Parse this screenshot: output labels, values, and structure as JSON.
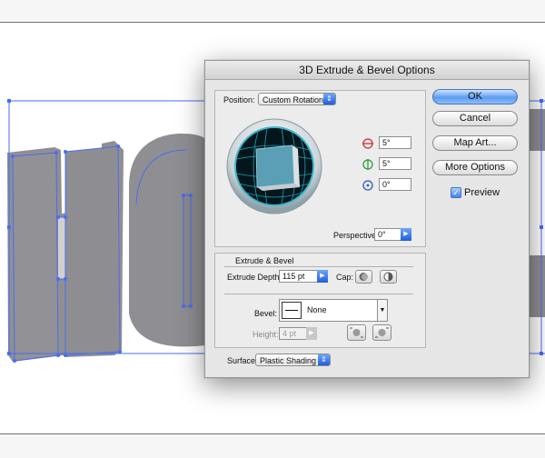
{
  "dialog": {
    "title": "3D Extrude & Bevel Options",
    "position": {
      "label": "Position:",
      "value": "Custom Rotation",
      "x_rotation": "5°",
      "y_rotation": "5°",
      "z_rotation": "0°",
      "perspective_label": "Perspective:",
      "perspective_value": "0°"
    },
    "extrude_bevel": {
      "section_title": "Extrude & Bevel",
      "extrude_depth_label": "Extrude Depth:",
      "extrude_depth_value": "115 pt",
      "cap_label": "Cap:",
      "bevel_label": "Bevel:",
      "bevel_value": "None",
      "height_label": "Height:",
      "height_value": "4 pt"
    },
    "surface": {
      "label": "Surface:",
      "value": "Plastic Shading"
    },
    "buttons": {
      "ok": "OK",
      "cancel": "Cancel",
      "map_art": "Map Art...",
      "more_options": "More Options"
    },
    "preview": {
      "label": "Preview",
      "checked": true
    }
  },
  "colors": {
    "artwork_fill": "#8f8f93",
    "selection": "#4a6cf0",
    "cube_face": "#5a9fb5",
    "default_button": "#5c9cf2"
  }
}
